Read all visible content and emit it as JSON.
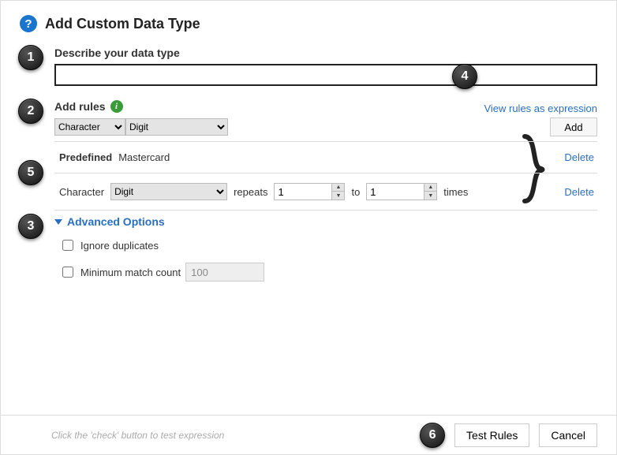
{
  "title": "Add Custom Data Type",
  "badges": {
    "b1": "1",
    "b2": "2",
    "b3": "3",
    "b4": "4",
    "b5": "5",
    "b6": "6"
  },
  "describe": {
    "label": "Describe your data type",
    "value": ""
  },
  "rules": {
    "header": "Add rules",
    "view_expr_link": "View rules as expression",
    "sel_character": "Character",
    "sel_sub": "Digit",
    "add_btn": "Add"
  },
  "rule_items": {
    "predefined_label": "Predefined",
    "predefined_value": "Mastercard",
    "char_label": "Character",
    "char_sel": "Digit",
    "repeats_label": "repeats",
    "repeats_from": "1",
    "to_label": "to",
    "repeats_to": "1",
    "times_label": "times",
    "delete_label": "Delete"
  },
  "advanced": {
    "header": "Advanced Options",
    "ignore_dup": "Ignore duplicates",
    "min_match": "Minimum match count",
    "min_match_value": "100"
  },
  "footer": {
    "hint": "Click the 'check' button to test expression",
    "test": "Test Rules",
    "cancel": "Cancel"
  }
}
